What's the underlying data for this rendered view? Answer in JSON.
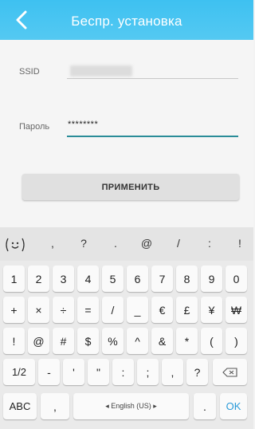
{
  "header": {
    "title": "Беспр. установка"
  },
  "form": {
    "ssid_label": "SSID",
    "password_label": "Пароль",
    "password_value": "********",
    "apply_label": "ПРИМЕНИТЬ"
  },
  "keyboard": {
    "suggestions": [
      ",",
      "?",
      ".",
      "@",
      "/",
      ":",
      "!"
    ],
    "row1": [
      "1",
      "2",
      "3",
      "4",
      "5",
      "6",
      "7",
      "8",
      "9",
      "0"
    ],
    "row2": [
      "+",
      "×",
      "÷",
      "=",
      "/",
      "_",
      "€",
      "£",
      "¥",
      "₩"
    ],
    "row3": [
      "!",
      "@",
      "#",
      "$",
      "%",
      "^",
      "&",
      "*",
      "(",
      ")"
    ],
    "row4": [
      "1/2",
      "-",
      "'",
      "\"",
      ":",
      ";",
      ",",
      "?"
    ],
    "row5": {
      "abc": "ABC",
      "comma": ",",
      "space": "◂ English (US) ▸",
      "period": ".",
      "ok": "OK"
    }
  }
}
